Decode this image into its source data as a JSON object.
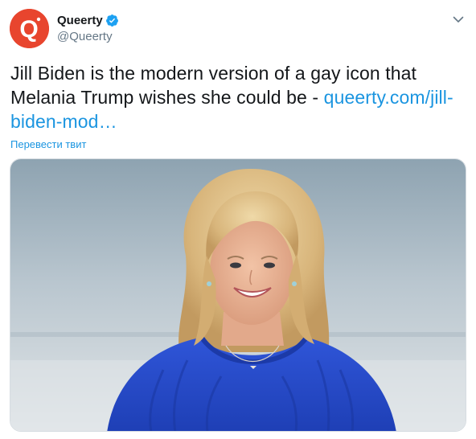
{
  "account": {
    "display_name": "Queerty",
    "handle": "@Queerty",
    "avatar_letter": "Q",
    "avatar_color": "#e8452e",
    "verified": true
  },
  "tweet": {
    "text_before_link": "Jill Biden is the modern version of a gay icon that Melania Trump wishes she could be - ",
    "link_text": "queerty.com/jill-biden-mod…",
    "translate_label": "Перевести твит"
  },
  "media": {
    "description_icon": "photo-of-smiling-woman-in-blue-sweater"
  },
  "colors": {
    "link": "#1b95e0",
    "text": "#14171a",
    "secondary": "#657786",
    "verified_badge": "#1da1f2"
  }
}
